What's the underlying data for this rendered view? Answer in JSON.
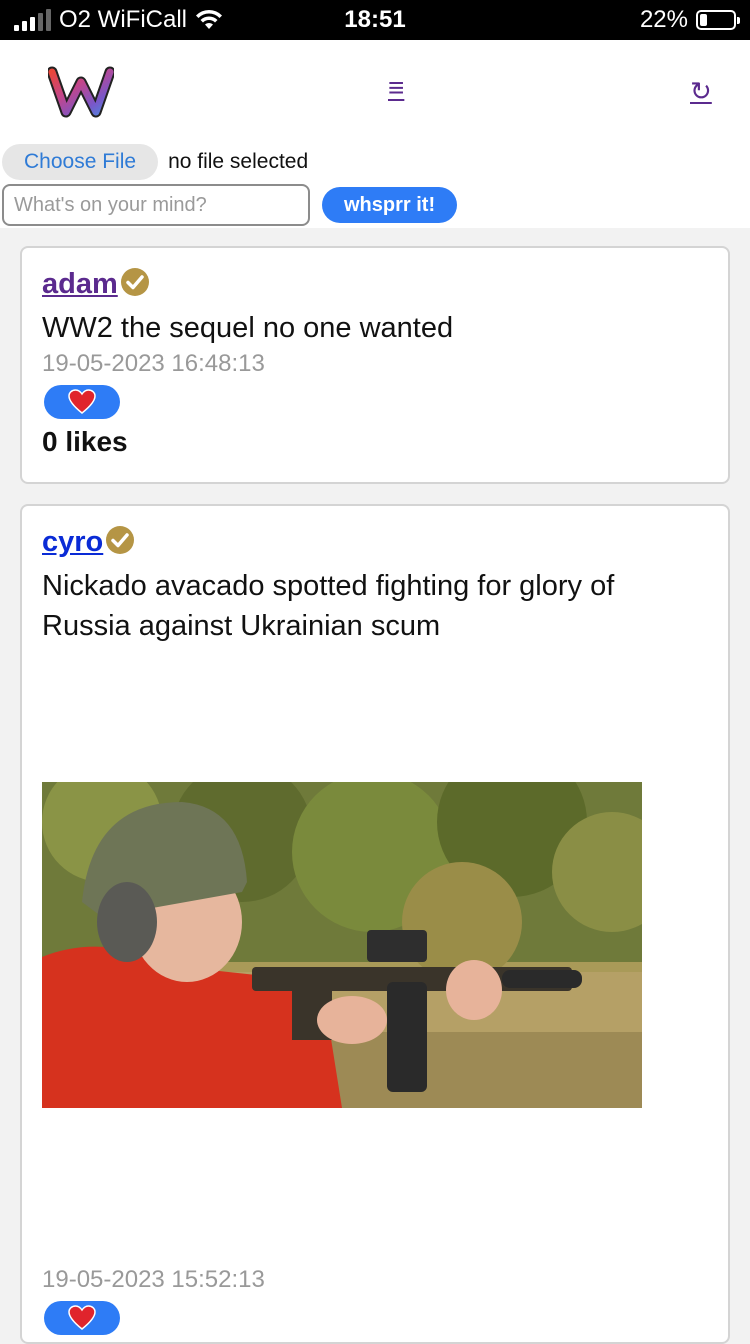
{
  "status_bar": {
    "carrier": "O2 WiFiCall",
    "time": "18:51",
    "battery_percent": "22%",
    "battery_level": 0.22
  },
  "header": {
    "logo_icon": "whsprr-w-logo-icon",
    "menu_label": "≡",
    "refresh_label": "↻"
  },
  "composer": {
    "choose_file_label": "Choose File",
    "file_status": "no file selected",
    "input_placeholder": "What's on your mind?",
    "input_value": "",
    "submit_label": "whsprr it!"
  },
  "colors": {
    "accent_blue": "#2e7cf6",
    "link_purple": "#5b2a8e",
    "link_blue": "#0a2bd6",
    "verified_gold": "#b59545",
    "like_heart": "#e0242c"
  },
  "posts": [
    {
      "username": "adam",
      "verified": true,
      "text": "WW2 the sequel no one wanted",
      "timestamp": "19-05-2023 16:48:13",
      "like_icon": "heart-icon",
      "likes_label": "0 likes"
    },
    {
      "username": "cyro",
      "verified": true,
      "text": "Nickado avacado spotted fighting for glory of Russia against Ukrainian scum",
      "image": "photo-man-with-rifle",
      "timestamp": "19-05-2023 15:52:13",
      "like_icon": "heart-icon"
    }
  ]
}
